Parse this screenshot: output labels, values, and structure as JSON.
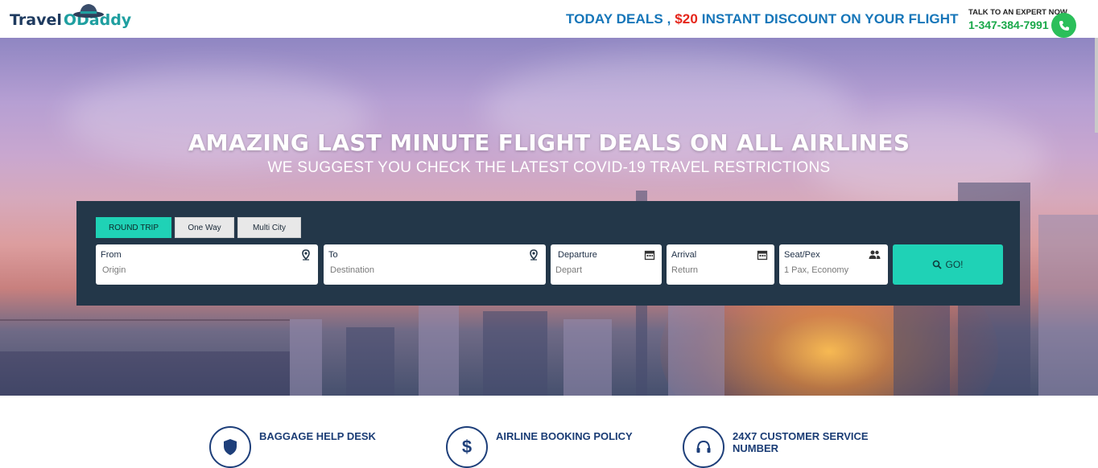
{
  "header": {
    "logo_part1": "Travel",
    "logo_part2": "Daddy",
    "logo_o": "O",
    "deals_prefix": "TODAY DEALS ,",
    "deals_amount": "$20",
    "deals_suffix": "INSTANT DISCOUNT ON YOUR FLIGHT",
    "expert_label": "TALK TO AN EXPERT NOW",
    "phone": "1-347-384-7991"
  },
  "hero": {
    "title": "AMAZING LAST MINUTE FLIGHT DEALS ON ALL AIRLINES",
    "subtitle": "WE SUGGEST YOU CHECK THE LATEST COVID-19 TRAVEL RESTRICTIONS"
  },
  "search": {
    "tabs": [
      {
        "label": "ROUND TRIP",
        "active": true
      },
      {
        "label": "One Way",
        "active": false
      },
      {
        "label": "Multi City",
        "active": false
      }
    ],
    "fields": [
      {
        "label": "From",
        "placeholder": "Origin",
        "icon": "map-pin-icon"
      },
      {
        "label": "To",
        "placeholder": "Destination",
        "icon": "map-pin-icon"
      },
      {
        "label": "Departure",
        "placeholder": "Depart",
        "icon": "calendar-icon"
      },
      {
        "label": "Arrival",
        "placeholder": "Return",
        "icon": "calendar-icon"
      },
      {
        "label": "Seat/Pex",
        "placeholder": "1 Pax, Economy",
        "icon": "people-icon"
      }
    ],
    "go_label": "GO!"
  },
  "services": [
    {
      "label": "BAGGAGE HELP DESK",
      "icon": "shield-icon"
    },
    {
      "label": "AIRLINE BOOKING POLICY",
      "icon": "dollar-icon"
    },
    {
      "label": "24X7 CUSTOMER SERVICE NUMBER",
      "icon": "headset-icon"
    }
  ],
  "colors": {
    "accent": "#1fd2b6",
    "panel": "#233749",
    "deal_blue": "#1676b9",
    "deal_red": "#e5261b",
    "phone_green": "#1aa84a"
  }
}
